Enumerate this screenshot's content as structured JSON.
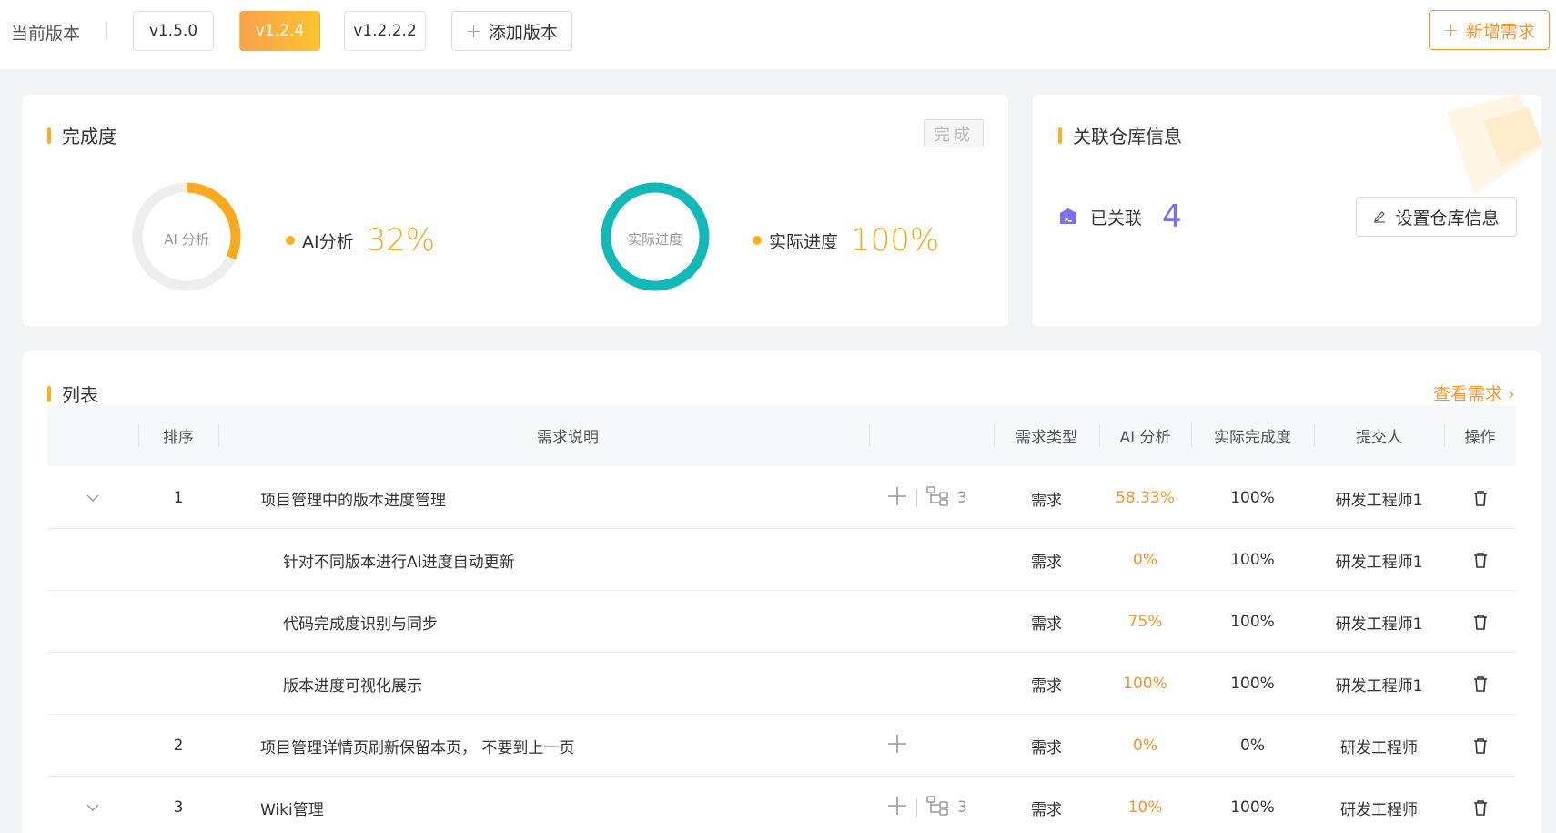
{
  "topbar": {
    "current_label": "当前版本",
    "versions": [
      "v1.5.0",
      "v1.2.4",
      "v1.2.2.2"
    ],
    "active_version": "v1.2.4",
    "add_version": "添加版本",
    "new_requirement": "新增需求"
  },
  "completion": {
    "title": "完成度",
    "status_tag": "完成",
    "ai": {
      "ring_label": "AI 分析",
      "legend": "AI分析",
      "value": "32%",
      "fraction": 0.32
    },
    "actual": {
      "ring_label": "实际进度",
      "legend": "实际进度",
      "value": "100%",
      "fraction": 1.0
    },
    "colors": {
      "ai": "#fbaa1f",
      "actual": "#13b8b8",
      "track": "#eeeeee"
    }
  },
  "repo": {
    "title": "关联仓库信息",
    "linked_label": "已关联",
    "linked_count": "4",
    "set_button": "设置仓库信息"
  },
  "list": {
    "title": "列表",
    "view_link": "查看需求",
    "columns": [
      "排序",
      "需求说明",
      "需求类型",
      "AI 分析",
      "实际完成度",
      "提交人",
      "操作"
    ],
    "rows": [
      {
        "expand": true,
        "order": "1",
        "desc": "项目管理中的版本进度管理",
        "sub_count": "3",
        "type": "需求",
        "ai": "58.33%",
        "actual": "100%",
        "submitter": "研发工程师1",
        "child": false,
        "add": true,
        "tree": true
      },
      {
        "expand": false,
        "order": "",
        "desc": "针对不同版本进行AI进度自动更新",
        "sub_count": "",
        "type": "需求",
        "ai": "0%",
        "actual": "100%",
        "submitter": "研发工程师1",
        "child": true,
        "add": false,
        "tree": false
      },
      {
        "expand": false,
        "order": "",
        "desc": "代码完成度识别与同步",
        "sub_count": "",
        "type": "需求",
        "ai": "75%",
        "actual": "100%",
        "submitter": "研发工程师1",
        "child": true,
        "add": false,
        "tree": false
      },
      {
        "expand": false,
        "order": "",
        "desc": "版本进度可视化展示",
        "sub_count": "",
        "type": "需求",
        "ai": "100%",
        "actual": "100%",
        "submitter": "研发工程师1",
        "child": true,
        "add": false,
        "tree": false
      },
      {
        "expand": false,
        "order": "2",
        "desc": "项目管理详情页刷新保留本页， 不要到上一页",
        "sub_count": "",
        "type": "需求",
        "ai": "0%",
        "actual": "0%",
        "submitter": "研发工程师",
        "child": false,
        "add": true,
        "tree": false
      },
      {
        "expand": true,
        "order": "3",
        "desc": "Wiki管理",
        "sub_count": "3",
        "type": "需求",
        "ai": "10%",
        "actual": "100%",
        "submitter": "研发工程师",
        "child": false,
        "add": true,
        "tree": true
      }
    ]
  }
}
